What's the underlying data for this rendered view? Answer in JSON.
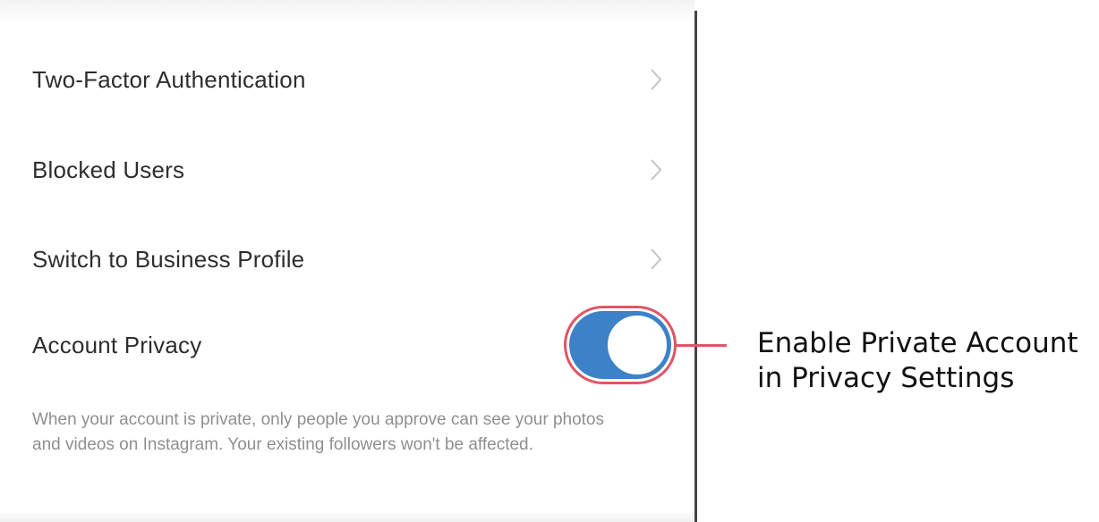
{
  "settings": {
    "items": [
      {
        "label": "Two-Factor Authentication"
      },
      {
        "label": "Blocked Users"
      },
      {
        "label": "Switch to Business Profile"
      }
    ],
    "privacy": {
      "label": "Account Privacy",
      "toggle_on": true,
      "description": "When your account is private, only people you approve can see your photos and videos on Instagram. Your existing followers won't be affected."
    }
  },
  "callout": {
    "line1": "Enable Private Account",
    "line2": "in Privacy Settings"
  },
  "colors": {
    "toggle_on": "#3d82c8",
    "highlight": "#e05566"
  },
  "icons": {
    "row_chevron": "chevron-right-icon"
  }
}
